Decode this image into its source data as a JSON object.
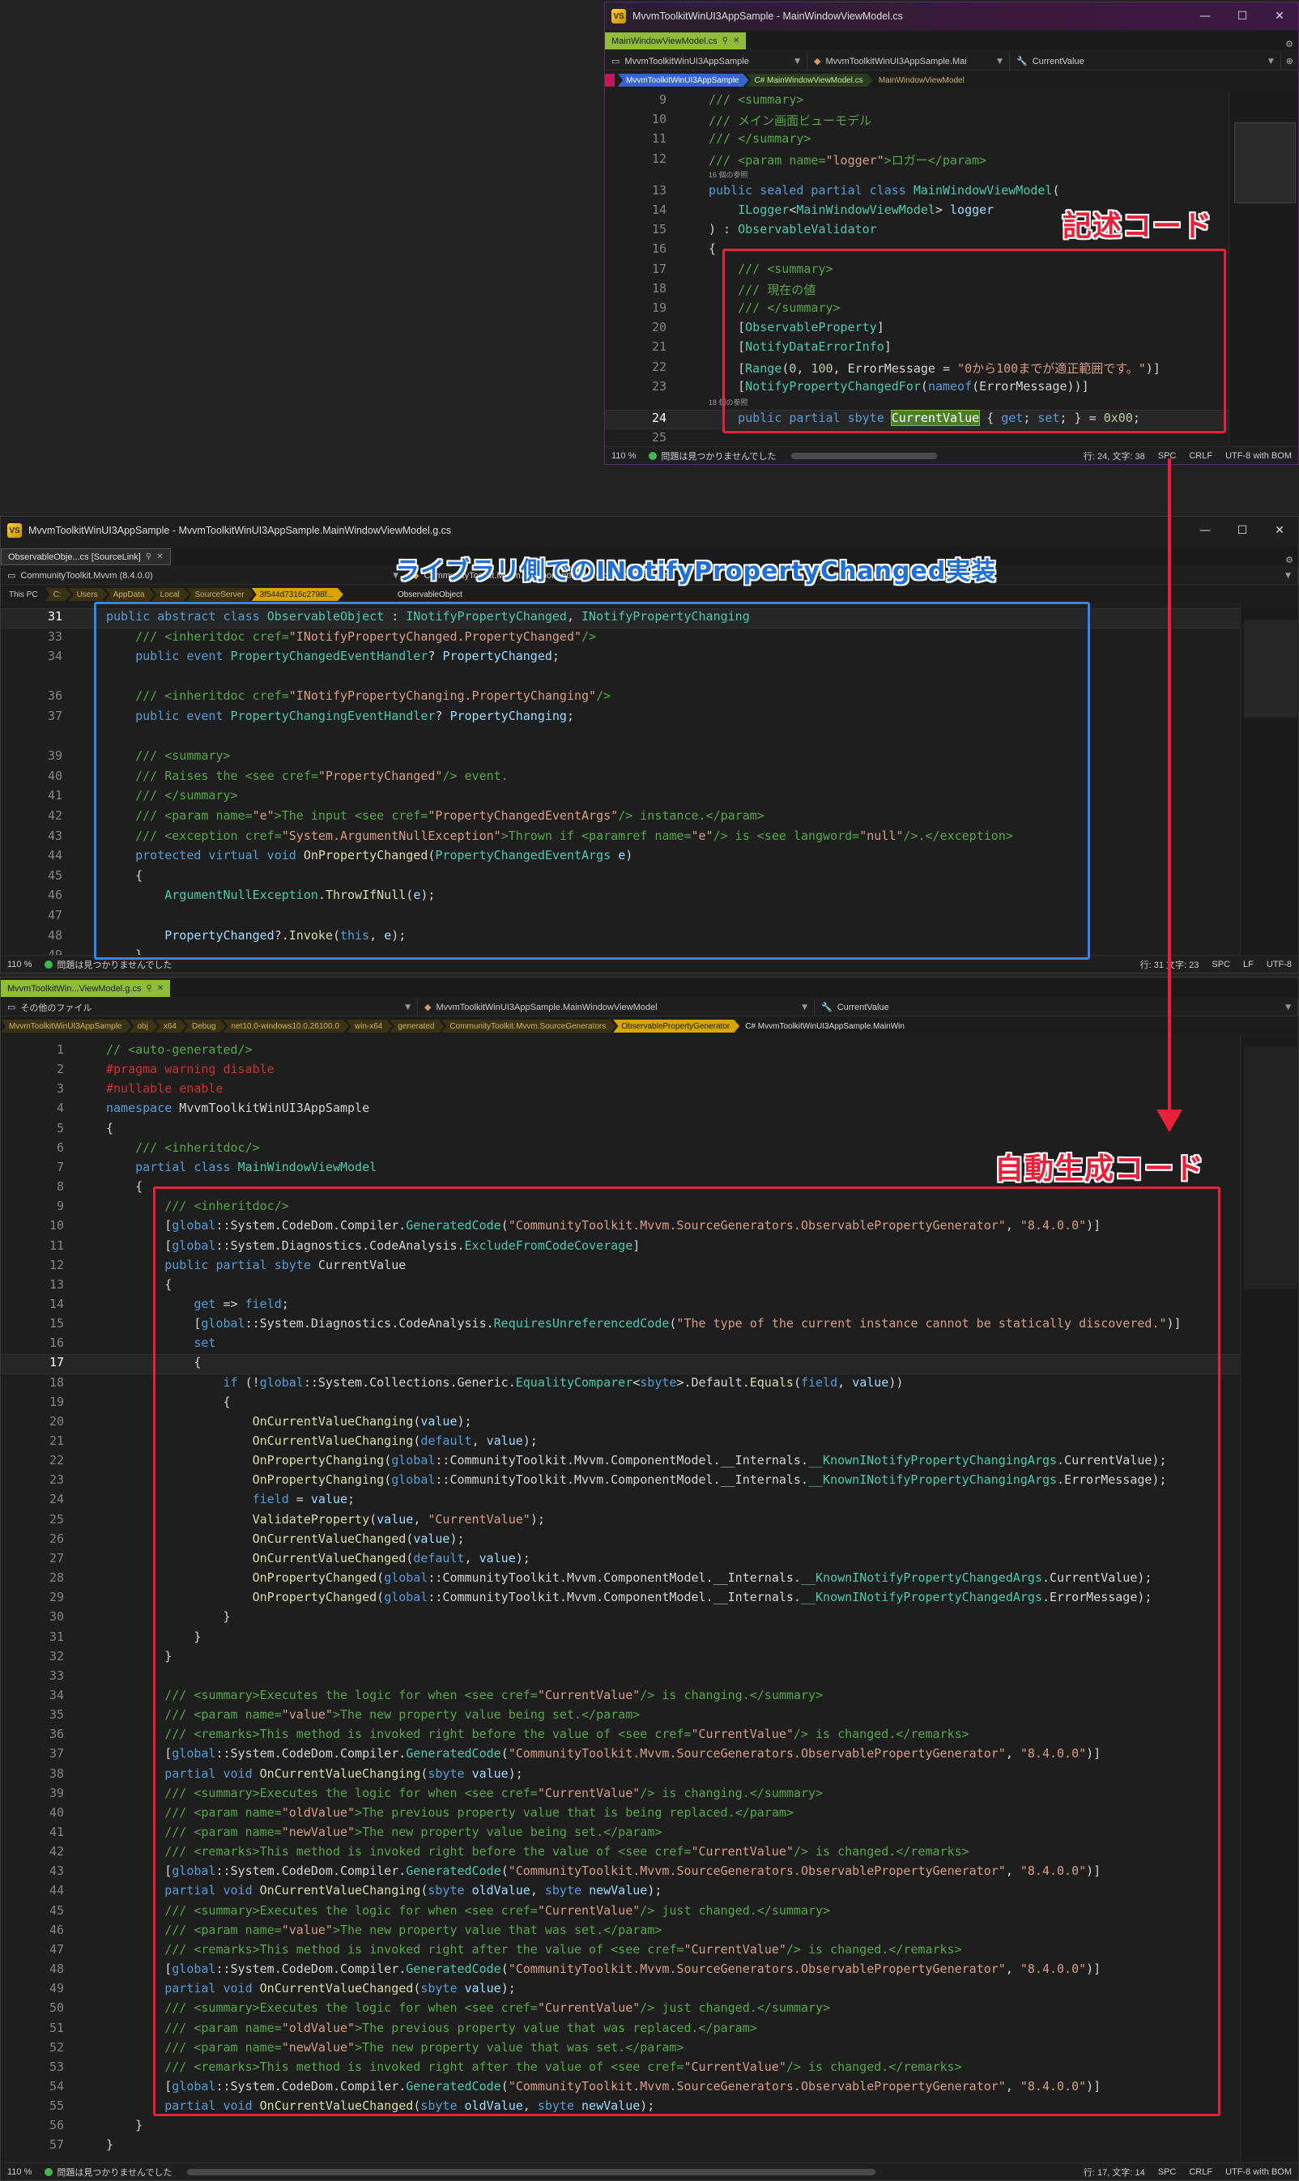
{
  "window1": {
    "title": "MvvmToolkitWinUI3AppSample - MainWindowViewModel.cs",
    "tab": "MainWindowViewModel.cs",
    "nav_project": "MvvmToolkitWinUI3AppSample",
    "nav_class": "MvvmToolkitWinUI3AppSample.Mai",
    "nav_member": "CurrentValue",
    "crumbs": [
      "MvvmToolkitWinUI3AppSample",
      "C# MainWindowViewModel.cs",
      "MainWindowViewModel"
    ],
    "status": {
      "zoom": "110 %",
      "issues": "問題は見つかりませんでした",
      "pos": "行: 24, 文字: 38",
      "spc": "SPC",
      "eol": "CRLF",
      "enc": "UTF-8 with BOM"
    }
  },
  "window2": {
    "title": "MvvmToolkitWinUI3AppSample - MvvmToolkitWinUI3AppSample.MainWindowViewModel.g.cs",
    "tab": "ObservableObje...cs [SourceLink]",
    "nav_project": "CommunityToolkit.Mvvm (8.4.0.0)",
    "nav_class": "CommunityToolkit.Mvvm.ComponentModel.ObservableObject",
    "nav_member": "PropertyChanged",
    "crumbs": [
      "This PC",
      "C:",
      "Users",
      "AppData",
      "Local",
      "SourceServer",
      "3f544d7316c2798f..."
    ],
    "crumb_last": "ObservableObject",
    "status": {
      "zoom": "110 %",
      "issues": "問題は見つかりませんでした",
      "pos": "行: 31 文字: 23",
      "spc": "SPC",
      "eol": "LF",
      "enc": "UTF-8"
    }
  },
  "window3": {
    "tab": "MvvmToolkitWin...ViewModel.g.cs",
    "nav_project": "その他のファイル",
    "nav_class": "MvvmToolkitWinUI3AppSample.MainWindowViewModel",
    "nav_member": "CurrentValue",
    "crumbs": [
      "MvvmToolkitWinUI3AppSample",
      "obj",
      "x64",
      "Debug",
      "net10.0-windows10.0.26100.0",
      "win-x64",
      "generated",
      "CommunityToolkit.Mvvm.SourceGenerators",
      "ObservablePropertyGenerator"
    ],
    "crumb_last": "C# MvvmToolkitWinUI3AppSample.MainWin",
    "status": {
      "zoom": "110 %",
      "issues": "問題は見つかりませんでした",
      "pos": "行: 17, 文字: 14",
      "spc": "SPC",
      "eol": "CRLF",
      "enc": "UTF-8 with BOM"
    }
  },
  "annotations": {
    "written_code": "記述コード",
    "library_impl": "ライブラリ側でのINotifyPropertyChanged実装",
    "generated_code": "自動生成コード"
  },
  "code1": [
    {
      "n": "9",
      "h": "<span class='c'>/// &lt;summary&gt;</span>"
    },
    {
      "n": "10",
      "h": "<span class='c'>/// メイン画面ビューモデル</span>"
    },
    {
      "n": "11",
      "h": "<span class='c'>/// &lt;/summary&gt;</span>"
    },
    {
      "n": "12",
      "h": "<span class='c'>/// &lt;param name=</span><span class='s'>\"logger\"</span><span class='c'>&gt;ロガー&lt;/param&gt;</span>"
    },
    {
      "ref": "16 個の参照"
    },
    {
      "n": "13",
      "h": "<span class='k'>public sealed partial class</span> <span class='t'>MainWindowViewModel</span>("
    },
    {
      "n": "14",
      "h": "    <span class='t'>ILogger</span>&lt;<span class='t'>MainWindowViewModel</span>&gt; <span class='p'>logger</span>"
    },
    {
      "n": "15",
      "h": ") : <span class='t'>ObservableValidator</span>"
    },
    {
      "n": "16",
      "h": "{"
    },
    {
      "n": "17",
      "h": "    <span class='c'>/// &lt;summary&gt;</span>"
    },
    {
      "n": "18",
      "h": "    <span class='c'>/// 現在の値</span>"
    },
    {
      "n": "19",
      "h": "    <span class='c'>/// &lt;/summary&gt;</span>"
    },
    {
      "n": "20",
      "h": "    [<span class='t'>ObservableProperty</span>]"
    },
    {
      "n": "21",
      "h": "    [<span class='t'>NotifyDataErrorInfo</span>]"
    },
    {
      "n": "22",
      "h": "    [<span class='t'>Range</span>(<span class='n'>0</span>, <span class='n'>100</span>, ErrorMessage = <span class='s'>\"0から100までが適正範囲です。\"</span>)]"
    },
    {
      "n": "23",
      "h": "    [<span class='t'>NotifyPropertyChangedFor</span>(<span class='k'>nameof</span>(ErrorMessage))]"
    },
    {
      "ref": "18 個の参照"
    },
    {
      "n": "24",
      "h": "    <span class='k'>public partial sbyte</span> <span class='hlw'>CurrentValue</span> { <span class='k'>get</span>; <span class='k'>set</span>; } = <span class='n'>0x00</span>;",
      "cur": true
    },
    {
      "n": "25",
      "h": ""
    }
  ],
  "code2": [
    {
      "n": "31",
      "h": "<span class='k'>public abstract class</span> <span class='t'>ObservableObject</span> : <span class='t'>INotifyPropertyChanged</span>, <span class='t'>INotifyPropertyChanging</span>",
      "cur": true
    },
    {
      "n": "33",
      "h": "    <span class='c'>/// &lt;inheritdoc cref=</span><span class='s'>\"INotifyPropertyChanged.PropertyChanged\"</span><span class='c'>/&gt;</span>"
    },
    {
      "n": "34",
      "h": "    <span class='k'>public event</span> <span class='t'>PropertyChangedEventHandler</span>? <span class='p'>PropertyChanged</span>;"
    },
    {
      "n": "",
      "h": ""
    },
    {
      "n": "36",
      "h": "    <span class='c'>/// &lt;inheritdoc cref=</span><span class='s'>\"INotifyPropertyChanging.PropertyChanging\"</span><span class='c'>/&gt;</span>"
    },
    {
      "n": "37",
      "h": "    <span class='k'>public event</span> <span class='t'>PropertyChangingEventHandler</span>? <span class='p'>PropertyChanging</span>;"
    },
    {
      "n": "",
      "h": ""
    },
    {
      "n": "39",
      "h": "    <span class='c'>/// &lt;summary&gt;</span>"
    },
    {
      "n": "40",
      "h": "    <span class='c'>/// Raises the &lt;see cref=</span><span class='s'>\"PropertyChanged\"</span><span class='c'>/&gt; event.</span>"
    },
    {
      "n": "41",
      "h": "    <span class='c'>/// &lt;/summary&gt;</span>"
    },
    {
      "n": "42",
      "h": "    <span class='c'>/// &lt;param name=</span><span class='s'>\"e\"</span><span class='c'>&gt;The input &lt;see cref=</span><span class='s'>\"PropertyChangedEventArgs\"</span><span class='c'>/&gt; instance.&lt;/param&gt;</span>"
    },
    {
      "n": "43",
      "h": "    <span class='c'>/// &lt;exception cref=</span><span class='s'>\"System.ArgumentNullException\"</span><span class='c'>&gt;Thrown if &lt;paramref name=</span><span class='s'>\"e\"</span><span class='c'>/&gt; is &lt;see langword=</span><span class='s'>\"null\"</span><span class='c'>/&gt;.&lt;/exception&gt;</span>"
    },
    {
      "n": "44",
      "h": "    <span class='k'>protected virtual void</span> <span class='m'>OnPropertyChanged</span>(<span class='t'>PropertyChangedEventArgs</span> <span class='p'>e</span>)"
    },
    {
      "n": "45",
      "h": "    {"
    },
    {
      "n": "46",
      "h": "        <span class='t'>ArgumentNullException</span>.<span class='m'>ThrowIfNull</span>(<span class='p'>e</span>);"
    },
    {
      "n": "47",
      "h": ""
    },
    {
      "n": "48",
      "h": "        <span class='p'>PropertyChanged</span>?.<span class='m'>Invoke</span>(<span class='k'>this</span>, <span class='p'>e</span>);"
    },
    {
      "n": "49",
      "h": "    }"
    }
  ],
  "code3": [
    {
      "n": "1",
      "h": "<span class='c'>// &lt;auto-generated/&gt;</span>"
    },
    {
      "n": "2",
      "h": "<span class='cx'>#pragma warning disable</span>"
    },
    {
      "n": "3",
      "h": "<span class='cx'>#nullable enable</span>"
    },
    {
      "n": "4",
      "h": "<span class='k'>namespace</span> MvvmToolkitWinUI3AppSample"
    },
    {
      "n": "5",
      "h": "{"
    },
    {
      "n": "6",
      "h": "    <span class='c'>/// &lt;inheritdoc/&gt;</span>"
    },
    {
      "n": "7",
      "h": "    <span class='k'>partial class</span> <span class='t'>MainWindowViewModel</span>"
    },
    {
      "n": "8",
      "h": "    {"
    },
    {
      "n": "9",
      "h": "        <span class='c'>/// &lt;inheritdoc/&gt;</span>"
    },
    {
      "n": "10",
      "h": "        [<span class='k'>global</span>::System.CodeDom.Compiler.<span class='t'>GeneratedCode</span>(<span class='s'>\"CommunityToolkit.Mvvm.SourceGenerators.ObservablePropertyGenerator\"</span>, <span class='s'>\"8.4.0.0\"</span>)]"
    },
    {
      "n": "11",
      "h": "        [<span class='k'>global</span>::System.Diagnostics.CodeAnalysis.<span class='t'>ExcludeFromCodeCoverage</span>]"
    },
    {
      "n": "12",
      "h": "        <span class='k'>public partial sbyte</span> CurrentValue"
    },
    {
      "n": "13",
      "h": "        {"
    },
    {
      "n": "14",
      "h": "            <span class='k'>get</span> =&gt; <span class='k'>field</span>;"
    },
    {
      "n": "15",
      "h": "            [<span class='k'>global</span>::System.Diagnostics.CodeAnalysis.<span class='t'>RequiresUnreferencedCode</span>(<span class='s'>\"The type of the current instance cannot be statically discovered.\"</span>)]"
    },
    {
      "n": "16",
      "h": "            <span class='k'>set</span>"
    },
    {
      "n": "17",
      "h": "            {",
      "cur": true
    },
    {
      "n": "18",
      "h": "                <span class='k'>if</span> (!<span class='k'>global</span>::System.Collections.Generic.<span class='t'>EqualityComparer</span>&lt;<span class='k'>sbyte</span>&gt;.Default.<span class='m'>Equals</span>(<span class='k'>field</span>, <span class='p'>value</span>))"
    },
    {
      "n": "19",
      "h": "                {"
    },
    {
      "n": "20",
      "h": "                    <span class='m'>OnCurrentValueChanging</span>(<span class='p'>value</span>);"
    },
    {
      "n": "21",
      "h": "                    <span class='m'>OnCurrentValueChanging</span>(<span class='k'>default</span>, <span class='p'>value</span>);"
    },
    {
      "n": "22",
      "h": "                    <span class='m'>OnPropertyChanging</span>(<span class='k'>global</span>::CommunityToolkit.Mvvm.ComponentModel.__Internals.<span class='t'>__KnownINotifyPropertyChangingArgs</span>.CurrentValue);"
    },
    {
      "n": "23",
      "h": "                    <span class='m'>OnPropertyChanging</span>(<span class='k'>global</span>::CommunityToolkit.Mvvm.ComponentModel.__Internals.<span class='t'>__KnownINotifyPropertyChangingArgs</span>.ErrorMessage);"
    },
    {
      "n": "24",
      "h": "                    <span class='k'>field</span> = <span class='p'>value</span>;"
    },
    {
      "n": "25",
      "h": "                    <span class='m'>ValidateProperty</span>(<span class='p'>value</span>, <span class='s'>\"CurrentValue\"</span>);"
    },
    {
      "n": "26",
      "h": "                    <span class='m'>OnCurrentValueChanged</span>(<span class='p'>value</span>);"
    },
    {
      "n": "27",
      "h": "                    <span class='m'>OnCurrentValueChanged</span>(<span class='k'>default</span>, <span class='p'>value</span>);"
    },
    {
      "n": "28",
      "h": "                    <span class='m'>OnPropertyChanged</span>(<span class='k'>global</span>::CommunityToolkit.Mvvm.ComponentModel.__Internals.<span class='t'>__KnownINotifyPropertyChangedArgs</span>.CurrentValue);"
    },
    {
      "n": "29",
      "h": "                    <span class='m'>OnPropertyChanged</span>(<span class='k'>global</span>::CommunityToolkit.Mvvm.ComponentModel.__Internals.<span class='t'>__KnownINotifyPropertyChangedArgs</span>.ErrorMessage);"
    },
    {
      "n": "30",
      "h": "                }"
    },
    {
      "n": "31",
      "h": "            }"
    },
    {
      "n": "32",
      "h": "        }"
    },
    {
      "n": "33",
      "h": ""
    },
    {
      "n": "34",
      "h": "        <span class='c'>/// &lt;summary&gt;Executes the logic for when &lt;see cref=</span><span class='s'>\"CurrentValue\"</span><span class='c'>/&gt; is changing.&lt;/summary&gt;</span>"
    },
    {
      "n": "35",
      "h": "        <span class='c'>/// &lt;param name=</span><span class='s'>\"value\"</span><span class='c'>&gt;The new property value being set.&lt;/param&gt;</span>"
    },
    {
      "n": "36",
      "h": "        <span class='c'>/// &lt;remarks&gt;This method is invoked right before the value of &lt;see cref=</span><span class='s'>\"CurrentValue\"</span><span class='c'>/&gt; is changed.&lt;/remarks&gt;</span>"
    },
    {
      "n": "37",
      "h": "        [<span class='k'>global</span>::System.CodeDom.Compiler.<span class='t'>GeneratedCode</span>(<span class='s'>\"CommunityToolkit.Mvvm.SourceGenerators.ObservablePropertyGenerator\"</span>, <span class='s'>\"8.4.0.0\"</span>)]"
    },
    {
      "n": "38",
      "h": "        <span class='k'>partial void</span> <span class='m'>OnCurrentValueChanging</span>(<span class='k'>sbyte</span> <span class='p'>value</span>);"
    },
    {
      "n": "39",
      "h": "        <span class='c'>/// &lt;summary&gt;Executes the logic for when &lt;see cref=</span><span class='s'>\"CurrentValue\"</span><span class='c'>/&gt; is changing.&lt;/summary&gt;</span>"
    },
    {
      "n": "40",
      "h": "        <span class='c'>/// &lt;param name=</span><span class='s'>\"oldValue\"</span><span class='c'>&gt;The previous property value that is being replaced.&lt;/param&gt;</span>"
    },
    {
      "n": "41",
      "h": "        <span class='c'>/// &lt;param name=</span><span class='s'>\"newValue\"</span><span class='c'>&gt;The new property value being set.&lt;/param&gt;</span>"
    },
    {
      "n": "42",
      "h": "        <span class='c'>/// &lt;remarks&gt;This method is invoked right before the value of &lt;see cref=</span><span class='s'>\"CurrentValue\"</span><span class='c'>/&gt; is changed.&lt;/remarks&gt;</span>"
    },
    {
      "n": "43",
      "h": "        [<span class='k'>global</span>::System.CodeDom.Compiler.<span class='t'>GeneratedCode</span>(<span class='s'>\"CommunityToolkit.Mvvm.SourceGenerators.ObservablePropertyGenerator\"</span>, <span class='s'>\"8.4.0.0\"</span>)]"
    },
    {
      "n": "44",
      "h": "        <span class='k'>partial void</span> <span class='m'>OnCurrentValueChanging</span>(<span class='k'>sbyte</span> <span class='p'>oldValue</span>, <span class='k'>sbyte</span> <span class='p'>newValue</span>);"
    },
    {
      "n": "45",
      "h": "        <span class='c'>/// &lt;summary&gt;Executes the logic for when &lt;see cref=</span><span class='s'>\"CurrentValue\"</span><span class='c'>/&gt; just changed.&lt;/summary&gt;</span>"
    },
    {
      "n": "46",
      "h": "        <span class='c'>/// &lt;param name=</span><span class='s'>\"value\"</span><span class='c'>&gt;The new property value that was set.&lt;/param&gt;</span>"
    },
    {
      "n": "47",
      "h": "        <span class='c'>/// &lt;remarks&gt;This method is invoked right after the value of &lt;see cref=</span><span class='s'>\"CurrentValue\"</span><span class='c'>/&gt; is changed.&lt;/remarks&gt;</span>"
    },
    {
      "n": "48",
      "h": "        [<span class='k'>global</span>::System.CodeDom.Compiler.<span class='t'>GeneratedCode</span>(<span class='s'>\"CommunityToolkit.Mvvm.SourceGenerators.ObservablePropertyGenerator\"</span>, <span class='s'>\"8.4.0.0\"</span>)]"
    },
    {
      "n": "49",
      "h": "        <span class='k'>partial void</span> <span class='m'>OnCurrentValueChanged</span>(<span class='k'>sbyte</span> <span class='p'>value</span>);"
    },
    {
      "n": "50",
      "h": "        <span class='c'>/// &lt;summary&gt;Executes the logic for when &lt;see cref=</span><span class='s'>\"CurrentValue\"</span><span class='c'>/&gt; just changed.&lt;/summary&gt;</span>"
    },
    {
      "n": "51",
      "h": "        <span class='c'>/// &lt;param name=</span><span class='s'>\"oldValue\"</span><span class='c'>&gt;The previous property value that was replaced.&lt;/param&gt;</span>"
    },
    {
      "n": "52",
      "h": "        <span class='c'>/// &lt;param name=</span><span class='s'>\"newValue\"</span><span class='c'>&gt;The new property value that was set.&lt;/param&gt;</span>"
    },
    {
      "n": "53",
      "h": "        <span class='c'>/// &lt;remarks&gt;This method is invoked right after the value of &lt;see cref=</span><span class='s'>\"CurrentValue\"</span><span class='c'>/&gt; is changed.&lt;/remarks&gt;</span>"
    },
    {
      "n": "54",
      "h": "        [<span class='k'>global</span>::System.CodeDom.Compiler.<span class='t'>GeneratedCode</span>(<span class='s'>\"CommunityToolkit.Mvvm.SourceGenerators.ObservablePropertyGenerator\"</span>, <span class='s'>\"8.4.0.0\"</span>)]"
    },
    {
      "n": "55",
      "h": "        <span class='k'>partial void</span> <span class='m'>OnCurrentValueChanged</span>(<span class='k'>sbyte</span> <span class='p'>oldValue</span>, <span class='k'>sbyte</span> <span class='p'>newValue</span>);"
    },
    {
      "n": "56",
      "h": "    }"
    },
    {
      "n": "57",
      "h": "}"
    }
  ]
}
